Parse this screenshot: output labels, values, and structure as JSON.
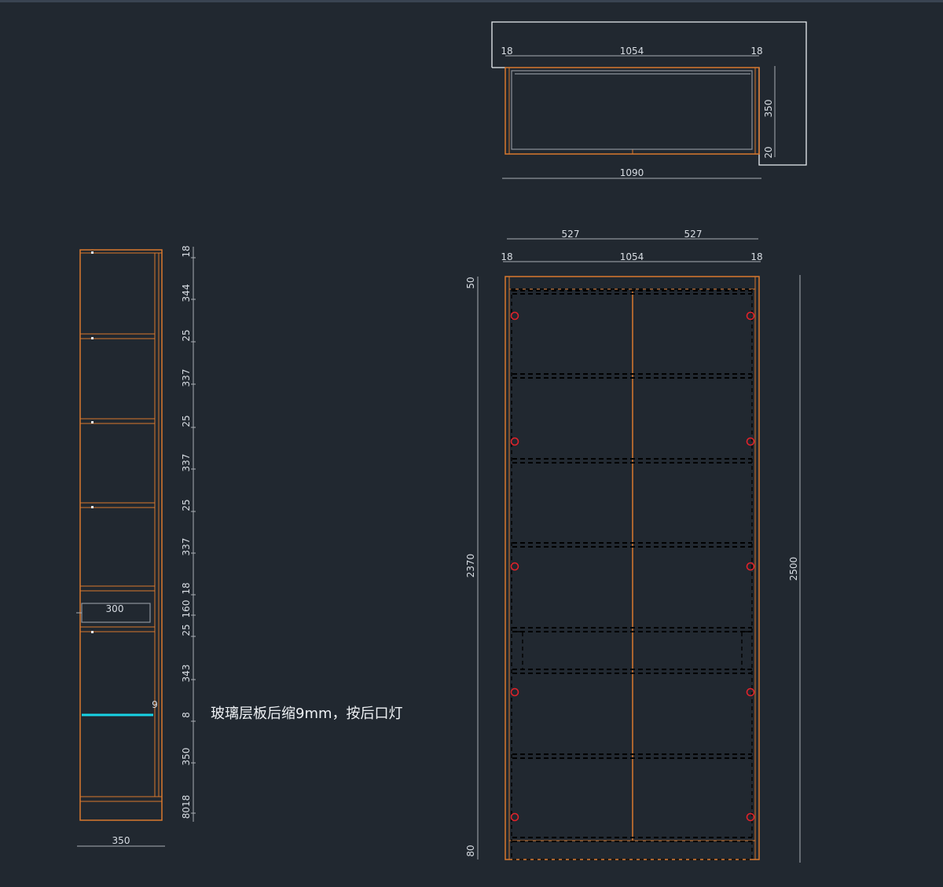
{
  "note": "玻璃层板后缩9mm，按后口灯",
  "top_view": {
    "dims": {
      "left_panel": "18",
      "inner_width": "1054",
      "right_panel": "18",
      "overall_width": "1090",
      "depth": "350",
      "back_gap": "20"
    }
  },
  "front_view": {
    "dims": {
      "door_left": "527",
      "door_right": "527",
      "left_panel": "18",
      "inner_width": "1054",
      "right_panel": "18",
      "top_strip": "50",
      "door_height": "2370",
      "plinth": "80",
      "total_height": "2500"
    }
  },
  "side_section": {
    "vertical_dims": [
      "18",
      "344",
      "25",
      "337",
      "25",
      "337",
      "25",
      "337",
      "18",
      "160",
      "25",
      "343",
      "8",
      "350",
      "8018"
    ],
    "drawer_depth": "300",
    "glass_setback": "9",
    "width": "350"
  },
  "colors": {
    "background": "#212830",
    "panel_lines": "#d9782d",
    "glass_shelf": "#17d4e6",
    "hinges": "#e0222a",
    "dimensions": "#a9aeb4"
  }
}
